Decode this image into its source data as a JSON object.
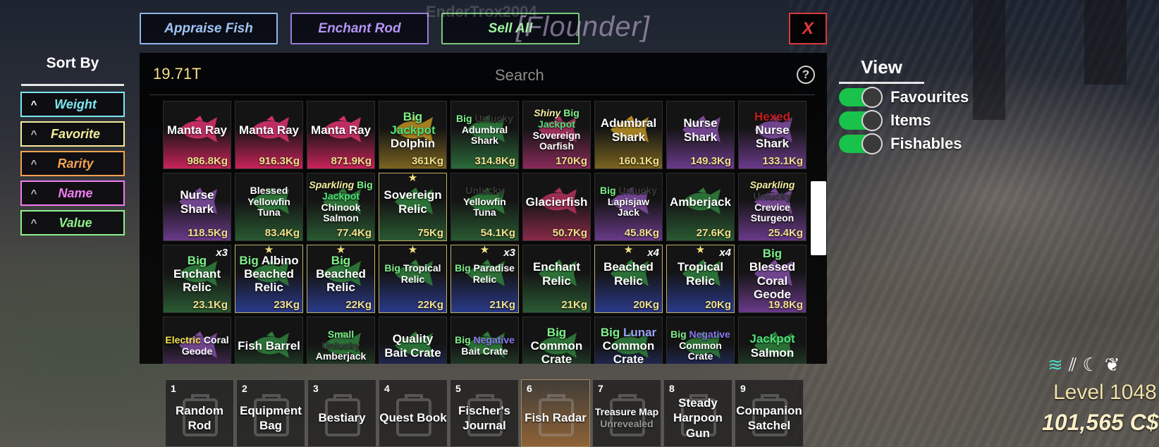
{
  "top_buttons": {
    "appraise": "Appraise Fish",
    "enchant": "Enchant Rod",
    "sell_all": "Sell All",
    "close": "X"
  },
  "player_name": "EnderTrox2004",
  "title_tag": "[Flounder]",
  "sort": {
    "title": "Sort By",
    "options": [
      {
        "label": "Weight",
        "color": "#7de8f0"
      },
      {
        "label": "Favorite",
        "color": "#f5ec9a"
      },
      {
        "label": "Rarity",
        "color": "#f2a152"
      },
      {
        "label": "Name",
        "color": "#f07cf2"
      },
      {
        "label": "Value",
        "color": "#8ef08a"
      }
    ]
  },
  "inventory": {
    "money": "19.71T",
    "search_placeholder": "Search",
    "items": [
      {
        "lines": [
          [
            [
              "Manta Ray",
              "#fff"
            ]
          ]
        ],
        "weight": "986.8Kg",
        "tint": "#c8235a",
        "fish": "#d0306a"
      },
      {
        "lines": [
          [
            [
              "Manta Ray",
              "#fff"
            ]
          ]
        ],
        "weight": "916.3Kg",
        "tint": "#c8235a",
        "fish": "#d0306a"
      },
      {
        "lines": [
          [
            [
              "Manta Ray",
              "#fff"
            ]
          ]
        ],
        "weight": "871.9Kg",
        "tint": "#c8235a",
        "fish": "#d0306a"
      },
      {
        "lines": [
          [
            [
              "Big",
              "#7ef08a"
            ]
          ],
          [
            [
              "Jackpot",
              "#4fe07a"
            ]
          ],
          [
            [
              "Dolphin",
              "#fff"
            ]
          ]
        ],
        "weight": "361Kg",
        "tint": "#7a6420",
        "fish": "#b38b22"
      },
      {
        "lines": [
          [
            [
              "Big ",
              "#7ef08a"
            ],
            [
              "Unlucky",
              "#3a3a3a"
            ]
          ],
          [
            [
              "Adumbral",
              "#fff"
            ]
          ],
          [
            [
              "Shark",
              "#fff"
            ]
          ]
        ],
        "weight": "314.8Kg",
        "tint": "#2a6a3a",
        "fish": "#2d7a3d",
        "small": true
      },
      {
        "lines": [
          [
            [
              "Shiny ",
              "#f4eea0",
              "i"
            ],
            [
              "Big",
              "#7ef08a"
            ]
          ],
          [
            [
              "Jackpot",
              "#4fe07a"
            ]
          ],
          [
            [
              "Sovereign",
              "#fff"
            ]
          ],
          [
            [
              "Oarfish",
              "#fff"
            ]
          ]
        ],
        "weight": "170Kg",
        "tint": "#8a2a5a",
        "fish": "#a83260",
        "small": true
      },
      {
        "lines": [
          [
            [
              "Adumbral",
              "#fff"
            ]
          ],
          [
            [
              "Shark",
              "#fff"
            ]
          ]
        ],
        "weight": "160.1Kg",
        "tint": "#7a6420",
        "fish": "#b38b22"
      },
      {
        "lines": [
          [
            [
              "Nurse",
              "#fff"
            ]
          ],
          [
            [
              "Shark",
              "#fff"
            ]
          ]
        ],
        "weight": "149.3Kg",
        "tint": "#6a3a8a",
        "fish": "#7a4a9a"
      },
      {
        "lines": [
          [
            [
              "Hexed",
              "#c81e1e"
            ]
          ],
          [
            [
              "Nurse",
              "#fff"
            ]
          ],
          [
            [
              "Shark",
              "#fff"
            ]
          ]
        ],
        "weight": "133.1Kg",
        "tint": "#6a3a8a",
        "fish": "#7a4a9a"
      },
      {
        "lines": [
          [
            [
              "Nurse",
              "#fff"
            ]
          ],
          [
            [
              "Shark",
              "#fff"
            ]
          ]
        ],
        "weight": "118.5Kg",
        "tint": "#6a3a8a",
        "fish": "#7a4a9a"
      },
      {
        "lines": [
          [
            [
              "Blessed",
              "#fff"
            ]
          ],
          [
            [
              "Yellowfin",
              "#fff"
            ]
          ],
          [
            [
              "Tuna",
              "#fff"
            ]
          ]
        ],
        "weight": "83.4Kg",
        "tint": "#2a5a32",
        "fish": "#2e7a3a",
        "small": true
      },
      {
        "lines": [
          [
            [
              "Sparkling ",
              "#f4eea0",
              "i"
            ],
            [
              "Big",
              "#7ef08a"
            ]
          ],
          [
            [
              "Jackpot",
              "#4fe07a"
            ]
          ],
          [
            [
              "Chinook",
              "#fff"
            ]
          ],
          [
            [
              "Salmon",
              "#fff"
            ]
          ]
        ],
        "weight": "77.4Kg",
        "tint": "#2a5a32",
        "fish": "#2e7a3a",
        "small": true
      },
      {
        "lines": [
          [
            [
              "Sovereign",
              "#fff"
            ]
          ],
          [
            [
              "Relic",
              "#fff"
            ]
          ]
        ],
        "weight": "75Kg",
        "tint": "#2a5a32",
        "fish": "#2e7a3a",
        "star": true
      },
      {
        "lines": [
          [
            [
              "Unlucky",
              "#3a3a3a"
            ]
          ],
          [
            [
              "Yellowfin",
              "#fff"
            ]
          ],
          [
            [
              "Tuna",
              "#fff"
            ]
          ]
        ],
        "weight": "54.1Kg",
        "tint": "#2a5a32",
        "fish": "#2e7a3a",
        "small": true
      },
      {
        "lines": [
          [
            [
              "Glacierfish",
              "#fff"
            ]
          ]
        ],
        "weight": "50.7Kg",
        "tint": "#8a2a4a",
        "fish": "#a83058"
      },
      {
        "lines": [
          [
            [
              "Big ",
              "#7ef08a"
            ],
            [
              "Unlucky",
              "#3a3a3a"
            ]
          ],
          [
            [
              "Lapisjaw",
              "#fff"
            ]
          ],
          [
            [
              "Jack",
              "#fff"
            ]
          ]
        ],
        "weight": "45.8Kg",
        "tint": "#6a3a8a",
        "fish": "#7a4a9a",
        "small": true
      },
      {
        "lines": [
          [
            [
              "Amberjack",
              "#fff"
            ]
          ]
        ],
        "weight": "27.6Kg",
        "tint": "#2a5a32",
        "fish": "#2e7a3a"
      },
      {
        "lines": [
          [
            [
              "Sparkling",
              "#f4eea0",
              "i"
            ]
          ],
          [
            [
              "Unlucky",
              "#3a3a3a"
            ]
          ],
          [
            [
              "Crevice",
              "#fff"
            ]
          ],
          [
            [
              "Sturgeon",
              "#fff"
            ]
          ]
        ],
        "weight": "25.4Kg",
        "tint": "#6a3a8a",
        "fish": "#7a4a9a",
        "small": true
      },
      {
        "lines": [
          [
            [
              "Big",
              "#7ef08a"
            ]
          ],
          [
            [
              "Enchant",
              "#fff"
            ]
          ],
          [
            [
              "Relic",
              "#fff"
            ]
          ]
        ],
        "weight": "23.1Kg",
        "tint": "#2a5a32",
        "fish": "#2e7a3a",
        "mult": "x3"
      },
      {
        "lines": [
          [
            [
              "Big ",
              "#7ef08a"
            ],
            [
              "Albino",
              "#fff"
            ]
          ],
          [
            [
              "Beached",
              "#fff"
            ]
          ],
          [
            [
              "Relic",
              "#fff"
            ]
          ]
        ],
        "weight": "23Kg",
        "tint": "#2a3a8a",
        "fish": "#2e7a3a",
        "star": true
      },
      {
        "lines": [
          [
            [
              "Big",
              "#7ef08a"
            ]
          ],
          [
            [
              "Beached",
              "#fff"
            ]
          ],
          [
            [
              "Relic",
              "#fff"
            ]
          ]
        ],
        "weight": "22Kg",
        "tint": "#2a3a8a",
        "fish": "#2e7a3a",
        "star": true
      },
      {
        "lines": [
          [
            [
              "Big ",
              "#7ef08a"
            ],
            [
              "Tropical",
              "#fff"
            ]
          ],
          [
            [
              "Relic",
              "#fff"
            ]
          ]
        ],
        "weight": "22Kg",
        "tint": "#2a3a8a",
        "fish": "#2e7a3a",
        "star": true,
        "small": true
      },
      {
        "lines": [
          [
            [
              "Big ",
              "#7ef08a"
            ],
            [
              "Paradise",
              "#fff"
            ]
          ],
          [
            [
              "Relic",
              "#fff"
            ]
          ]
        ],
        "weight": "21Kg",
        "tint": "#2a3a8a",
        "fish": "#2e7a3a",
        "star": true,
        "mult": "x3",
        "small": true
      },
      {
        "lines": [
          [
            [
              "Enchant",
              "#fff"
            ]
          ],
          [
            [
              "Relic",
              "#fff"
            ]
          ]
        ],
        "weight": "21Kg",
        "tint": "#2a5a32",
        "fish": "#2e7a3a"
      },
      {
        "lines": [
          [
            [
              "Beached",
              "#fff"
            ]
          ],
          [
            [
              "Relic",
              "#fff"
            ]
          ]
        ],
        "weight": "20Kg",
        "tint": "#2a3a8a",
        "fish": "#2e7a3a",
        "star": true,
        "mult": "x4"
      },
      {
        "lines": [
          [
            [
              "Tropical",
              "#fff"
            ]
          ],
          [
            [
              "Relic",
              "#fff"
            ]
          ]
        ],
        "weight": "20Kg",
        "tint": "#2a3a8a",
        "fish": "#2e7a3a",
        "star": true,
        "mult": "x4"
      },
      {
        "lines": [
          [
            [
              "Big ",
              "#7ef08a"
            ],
            [
              "Blessed",
              "#fff"
            ]
          ],
          [
            [
              "Coral",
              "#fff"
            ]
          ],
          [
            [
              "Geode",
              "#fff"
            ]
          ]
        ],
        "weight": "19.8Kg",
        "tint": "#6a3a8a",
        "fish": "#7a4a9a"
      },
      {
        "lines": [
          [
            [
              "Electric ",
              "#f2e04a"
            ],
            [
              "Coral",
              "#fff"
            ]
          ],
          [
            [
              "Geode",
              "#fff"
            ]
          ]
        ],
        "weight": "",
        "tint": "#6a3a8a",
        "fish": "#7a4a9a",
        "small": true
      },
      {
        "lines": [
          [
            [
              "Fish Barrel",
              "#fff"
            ]
          ]
        ],
        "weight": "",
        "tint": "#2a5a32",
        "fish": "#2e7a3a"
      },
      {
        "lines": [
          [
            [
              "Small",
              "#7ef08a"
            ]
          ],
          [
            [
              "Unlucky",
              "#3a3a3a"
            ]
          ],
          [
            [
              "Amberjack",
              "#fff"
            ]
          ]
        ],
        "weight": "",
        "tint": "#2a5a32",
        "fish": "#2e7a3a",
        "small": true
      },
      {
        "lines": [
          [
            [
              "Quality",
              "#fff"
            ]
          ],
          [
            [
              "Bait Crate",
              "#fff"
            ]
          ]
        ],
        "weight": "",
        "tint": "#2a3a8a",
        "fish": "#2e7a3a"
      },
      {
        "lines": [
          [
            [
              "Big ",
              "#7ef08a"
            ],
            [
              "Negative",
              "#8a7af0"
            ]
          ],
          [
            [
              "Bait Crate",
              "#fff"
            ]
          ]
        ],
        "weight": "",
        "tint": "#2a5a32",
        "fish": "#2e7a3a",
        "small": true
      },
      {
        "lines": [
          [
            [
              "Big",
              "#7ef08a"
            ]
          ],
          [
            [
              "Common",
              "#fff"
            ]
          ],
          [
            [
              "Crate",
              "#fff"
            ]
          ]
        ],
        "weight": "",
        "tint": "#2a5a32",
        "fish": "#2e7a3a"
      },
      {
        "lines": [
          [
            [
              "Big ",
              "#7ef08a"
            ],
            [
              "Lunar",
              "#9aa4f4"
            ]
          ],
          [
            [
              "Common",
              "#fff"
            ]
          ],
          [
            [
              "Crate",
              "#fff"
            ]
          ]
        ],
        "weight": "",
        "tint": "#2a3a8a",
        "fish": "#2e7a3a"
      },
      {
        "lines": [
          [
            [
              "Big ",
              "#7ef08a"
            ],
            [
              "Negative",
              "#8a7af0"
            ]
          ],
          [
            [
              "Common",
              "#fff"
            ]
          ],
          [
            [
              "Crate",
              "#fff"
            ]
          ]
        ],
        "weight": "",
        "tint": "#2a3a8a",
        "fish": "#2e7a3a",
        "small": true
      },
      {
        "lines": [
          [
            [
              "Jackpot",
              "#4fe07a"
            ]
          ],
          [
            [
              "Salmon",
              "#fff"
            ]
          ]
        ],
        "weight": "",
        "tint": "#2a5a32",
        "fish": "#2e7a3a"
      }
    ]
  },
  "view": {
    "title": "View",
    "toggles": [
      {
        "label": "Favourites",
        "on": true
      },
      {
        "label": "Items",
        "on": true
      },
      {
        "label": "Fishables",
        "on": true
      }
    ]
  },
  "hotbar": [
    {
      "num": "1",
      "lines": [
        "Random",
        "Rod"
      ],
      "icon": "fishing-rod-icon"
    },
    {
      "num": "2",
      "lines": [
        "Equipment",
        "Bag"
      ],
      "icon": "bag-icon"
    },
    {
      "num": "3",
      "lines": [
        "Bestiary"
      ],
      "icon": "book-icon"
    },
    {
      "num": "4",
      "lines": [
        "Quest Book"
      ],
      "icon": "book-icon"
    },
    {
      "num": "5",
      "lines": [
        "Fischer's",
        "Journal"
      ],
      "icon": "journal-icon"
    },
    {
      "num": "6",
      "lines": [
        "Fish Radar"
      ],
      "icon": "radar-icon",
      "active": true
    },
    {
      "num": "7",
      "lines": [
        "Treasure Map",
        "Unrevealed"
      ],
      "icon": "map-icon",
      "sub": true
    },
    {
      "num": "8",
      "lines": [
        "Steady",
        "Harpoon",
        "Gun"
      ],
      "icon": "harpoon-icon"
    },
    {
      "num": "9",
      "lines": [
        "Companion",
        "Satchel"
      ],
      "icon": "satchel-icon"
    }
  ],
  "hud": {
    "icons": [
      "wave-icon",
      "rain-icon",
      "moon-icon",
      "leaf-icon"
    ],
    "level": "Level 1048",
    "cash": "101,565 C$"
  }
}
